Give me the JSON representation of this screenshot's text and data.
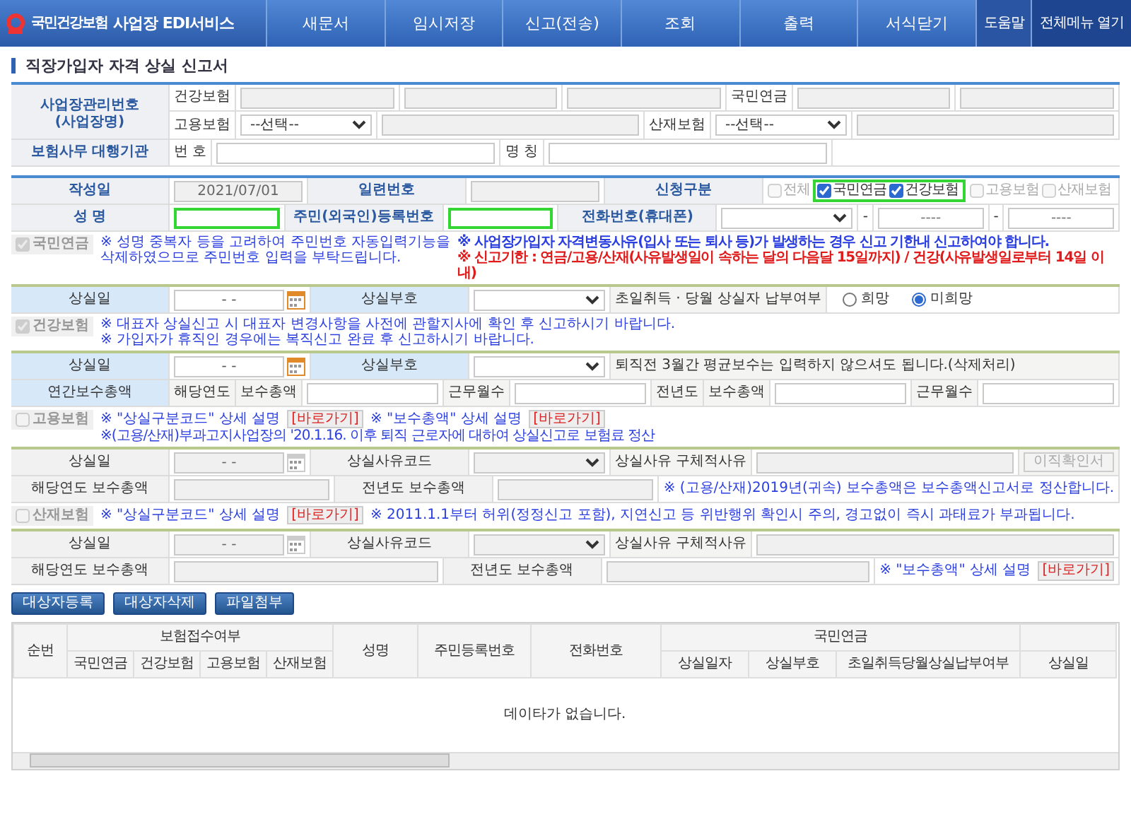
{
  "header": {
    "logo_text": "국민건강보험",
    "title": "사업장 EDI서비스",
    "menu": [
      {
        "label": "새문서"
      },
      {
        "label": "임시저장"
      },
      {
        "label": "신고(전송)"
      },
      {
        "label": "조회"
      },
      {
        "label": "출력"
      },
      {
        "label": "서식닫기"
      }
    ],
    "help": "도움말",
    "all_menu": "전체메뉴 열기"
  },
  "page_title": "직장가입자 자격 상실 신고서",
  "workplace": {
    "label": [
      "사업장관리번호",
      "(사업장명)"
    ],
    "rows": [
      {
        "cells": [
          {
            "kind": "sublabel",
            "text": "건강보험"
          },
          {
            "kind": "input",
            "disabled": true
          },
          {
            "kind": "input",
            "disabled": true
          },
          {
            "kind": "input",
            "disabled": true
          },
          {
            "kind": "sublabel",
            "text": "국민연금"
          },
          {
            "kind": "input",
            "disabled": true
          },
          {
            "kind": "input",
            "disabled": true
          }
        ]
      },
      {
        "cells": [
          {
            "kind": "sublabel",
            "text": "고용보험"
          },
          {
            "kind": "select",
            "value": "--선택--"
          },
          {
            "kind": "input",
            "disabled": true
          },
          {
            "kind": "sublabel",
            "text": "산재보험"
          },
          {
            "kind": "select",
            "value": "--선택--"
          },
          {
            "kind": "input",
            "disabled": true
          }
        ]
      }
    ]
  },
  "agency": {
    "rows": [
      {
        "cells": [
          {
            "kind": "label",
            "text": "보험사무 대행기관"
          },
          {
            "kind": "sublabel",
            "text": "번 호"
          },
          {
            "kind": "input",
            "disabled": false
          },
          {
            "kind": "sublabel",
            "text": "명 칭"
          },
          {
            "kind": "input",
            "disabled": false
          }
        ]
      }
    ]
  },
  "entry": {
    "rows": [
      {
        "cells": [
          {
            "kind": "label",
            "text": "작성일"
          },
          {
            "kind": "input",
            "value": "2021/07/01",
            "disabled": true
          },
          {
            "kind": "label",
            "text": "일련번호"
          },
          {
            "kind": "input",
            "disabled": true
          },
          {
            "kind": "label",
            "text": "신청구분"
          },
          {
            "kind": "checks",
            "items": [
              {
                "label": "전체",
                "checked": false,
                "disabled": true,
                "highlighted": false
              },
              {
                "label": "국민연금",
                "checked": true,
                "disabled": false,
                "highlighted": true
              },
              {
                "label": "건강보험",
                "checked": true,
                "disabled": false,
                "highlighted": true
              },
              {
                "label": "고용보험",
                "checked": false,
                "disabled": true,
                "highlighted": false
              },
              {
                "label": "산재보험",
                "checked": false,
                "disabled": true,
                "highlighted": false
              }
            ]
          }
        ]
      },
      {
        "cells": [
          {
            "kind": "label",
            "text": "성 명"
          },
          {
            "kind": "input",
            "disabled": false,
            "highlighted": true
          },
          {
            "kind": "label",
            "text": "주민(외국인)등록번호"
          },
          {
            "kind": "input",
            "disabled": false,
            "highlighted": true
          },
          {
            "kind": "label",
            "text": "전화번호(휴대폰)"
          },
          {
            "kind": "select"
          },
          {
            "kind": "sep",
            "text": "-"
          },
          {
            "kind": "input",
            "placeholder": "----",
            "disabled": false
          },
          {
            "kind": "sep",
            "text": "-"
          },
          {
            "kind": "input",
            "placeholder": "----",
            "disabled": false
          }
        ]
      }
    ]
  },
  "sections": [
    {
      "label": "국민연금",
      "checked": true,
      "disabled": true,
      "note_blocks": [
        [
          [
            {
              "kind": "info",
              "text": "※ 성명 중복자 등을 고려하여 주민번호 자동입력기능을"
            }
          ],
          [
            {
              "kind": "info",
              "text": "삭제하였으므로 주민번호 입력을 부탁드립니다."
            }
          ]
        ],
        [
          [
            {
              "kind": "info_strong",
              "text": "※ 사업장가입자 자격변동사유(입사 또는 퇴사 등)가 발생하는 경우 신고 기한내 신고하여야 합니다."
            }
          ],
          [
            {
              "kind": "alert_strong",
              "text": "※ 신고기한 : 연금/고용/산재(사유발생일이 속하는 달의 다음달 15일까지) / 건강(사유발생일로부터 14일 이내)"
            }
          ]
        ]
      ],
      "rows": [
        {
          "cells": [
            {
              "kind": "label",
              "text": "상실일"
            },
            {
              "kind": "date",
              "value": "- -",
              "disabled": false
            },
            {
              "kind": "label",
              "text": "상실부호"
            },
            {
              "kind": "select",
              "disabled": false
            },
            {
              "kind": "sublabel",
              "text": "초일취득 · 당월 상실자 납부여부"
            },
            {
              "kind": "radios",
              "options": [
                {
                  "label": "희망",
                  "selected": false
                },
                {
                  "label": "미희망",
                  "selected": true
                }
              ]
            }
          ]
        }
      ]
    },
    {
      "label": "건강보험",
      "checked": true,
      "disabled": true,
      "note_blocks": [
        [
          [
            {
              "kind": "info",
              "text": "※ 대표자 상실신고 시 대표자 변경사항을 사전에 관할지사에 확인 후 신고하시기 바랍니다."
            }
          ],
          [
            {
              "kind": "info",
              "text": "※ 가입자가 휴직인 경우에는 복직신고 완료 후 신고하시기 바랍니다."
            }
          ]
        ]
      ],
      "rows": [
        {
          "cells": [
            {
              "kind": "label",
              "text": "상실일"
            },
            {
              "kind": "date",
              "value": "- -",
              "disabled": false
            },
            {
              "kind": "label",
              "text": "상실부호"
            },
            {
              "kind": "select",
              "disabled": false
            }
          ],
          "remark": "퇴직전 3월간 평균보수는 입력하지 않으셔도 됩니다.(삭제처리)"
        },
        {
          "cells": [
            {
              "kind": "label",
              "text": "연간보수총액"
            },
            {
              "kind": "sublabel",
              "text": "해당연도"
            },
            {
              "kind": "sublabel",
              "text": "보수총액"
            },
            {
              "kind": "input",
              "disabled": false
            },
            {
              "kind": "sublabel",
              "text": "근무월수"
            },
            {
              "kind": "input",
              "disabled": false
            },
            {
              "kind": "sublabel",
              "text": "전년도"
            },
            {
              "kind": "sublabel",
              "text": "보수총액"
            },
            {
              "kind": "input",
              "disabled": false
            },
            {
              "kind": "sublabel",
              "text": "근무월수"
            },
            {
              "kind": "input",
              "disabled": false
            }
          ]
        }
      ]
    },
    {
      "label": "고용보험",
      "checked": false,
      "disabled": true,
      "note_blocks": [
        [
          [
            {
              "kind": "info",
              "text": "※ \"상실구분코드\" 상세 설명"
            },
            {
              "kind": "link",
              "text": "[바로가기]"
            },
            {
              "kind": "info",
              "text": "※ \"보수총액\" 상세 설명"
            },
            {
              "kind": "link",
              "text": "[바로가기]"
            },
            {
              "kind": "info_small",
              "text": "※(고용/산재)부과고지사업장의 '20.1.16. 이후 퇴직 근로자에 대하여 상실신고로 보험료 정산"
            }
          ]
        ]
      ],
      "rows": [
        {
          "cells": [
            {
              "kind": "label",
              "text": "상실일"
            },
            {
              "kind": "date",
              "value": "- -",
              "disabled": true
            },
            {
              "kind": "label",
              "text": "상실사유코드"
            },
            {
              "kind": "select",
              "disabled": true
            },
            {
              "kind": "sublabel",
              "text": "상실사유 구체적사유"
            },
            {
              "kind": "input",
              "disabled": true
            },
            {
              "kind": "button",
              "text": "이직확인서",
              "disabled": true
            }
          ]
        },
        {
          "cells": [
            {
              "kind": "label",
              "text": "해당연도 보수총액"
            },
            {
              "kind": "input",
              "disabled": true
            },
            {
              "kind": "label",
              "text": "전년도 보수총액"
            },
            {
              "kind": "input",
              "disabled": true
            },
            {
              "kind": "note",
              "segments": [
                {
                  "kind": "info",
                  "text": "※ (고용/산재)2019년(귀속) 보수총액은 보수총액신고서로 정산합니다."
                }
              ]
            }
          ]
        }
      ]
    },
    {
      "label": "산재보험",
      "checked": false,
      "disabled": true,
      "note_blocks": [
        [
          [
            {
              "kind": "info",
              "text": "※ \"상실구분코드\" 상세 설명"
            },
            {
              "kind": "link",
              "text": "[바로가기]"
            },
            {
              "kind": "info",
              "text": "※ 2011.1.1부터 허위(정정신고 포함), 지연신고 등 위반행위 확인시 주의, 경고없이 즉시 과태료가 부과됩니다."
            }
          ]
        ]
      ],
      "rows": [
        {
          "cells": [
            {
              "kind": "label",
              "text": "상실일"
            },
            {
              "kind": "date",
              "value": "- -",
              "disabled": true
            },
            {
              "kind": "label",
              "text": "상실사유코드"
            },
            {
              "kind": "select",
              "disabled": true
            },
            {
              "kind": "sublabel",
              "text": "상실사유 구체적사유"
            },
            {
              "kind": "input",
              "disabled": true
            }
          ]
        },
        {
          "cells": [
            {
              "kind": "label",
              "text": "해당연도 보수총액"
            },
            {
              "kind": "input",
              "disabled": true
            },
            {
              "kind": "label",
              "text": "전년도 보수총액"
            },
            {
              "kind": "input",
              "disabled": true
            },
            {
              "kind": "note",
              "segments": [
                {
                  "kind": "info",
                  "text": "※ \"보수총액\" 상세 설명"
                },
                {
                  "kind": "link",
                  "text": "[바로가기]"
                }
              ]
            }
          ]
        }
      ]
    }
  ],
  "actions": [
    "대상자등록",
    "대상자삭제",
    "파일첨부"
  ],
  "grid": {
    "top": [
      "순번",
      "보험접수여부",
      "성명",
      "주민등록번호",
      "전화번호",
      "국민연금"
    ],
    "bottom": [
      "국민연금",
      "건강보험",
      "고용보험",
      "산재보험",
      "상실일자",
      "상실부호",
      "초일취득당월상실납부여부",
      "상실일"
    ],
    "empty": "데이타가 없습니다."
  }
}
